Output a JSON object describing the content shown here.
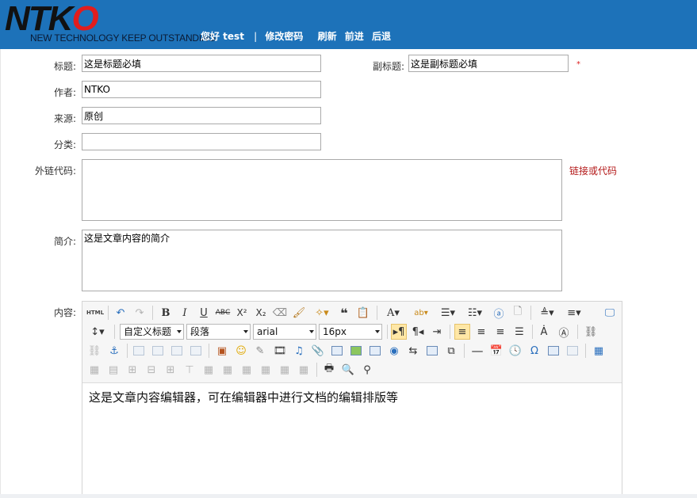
{
  "header": {
    "logo_text": "NTKO",
    "slogan": "NEW TECHNOLOGY KEEP OUTSTANDING",
    "greeting": "您好 test",
    "separator": "|",
    "change_password": "修改密码",
    "refresh": "刷新",
    "forward": "前进",
    "back": "后退"
  },
  "form": {
    "title_label": "标题:",
    "title_value": "这是标题必填",
    "subtitle_label": "副标题:",
    "subtitle_value": "这是副标题必填",
    "required_star": "*",
    "author_label": "作者:",
    "author_value": "NTKO",
    "source_label": "来源:",
    "source_value": "原创",
    "category_label": "分类:",
    "category_value": "",
    "link_label": "外链代码:",
    "link_value": "",
    "link_hint": "链接或代码",
    "summary_label": "简介:",
    "summary_value": "这是文章内容的简介",
    "content_label": "内容:"
  },
  "editor": {
    "custom_title": "自定义标题",
    "paragraph": "段落",
    "font": "arial",
    "size": "16px",
    "body_text": "这是文章内容编辑器，可在编辑器中进行文档的编辑排版等",
    "html_label": "HTML"
  },
  "colors": {
    "header_bg": "#1d72b9",
    "required": "#d22222",
    "hint": "#b31818"
  }
}
